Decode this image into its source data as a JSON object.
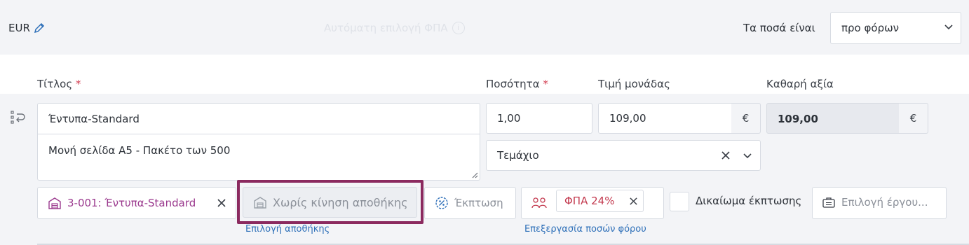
{
  "topbar": {
    "currency": "EUR",
    "currency_edit_icon": "pencil-icon",
    "ghost_text": "Αυτόματη επιλογή ΦΠΑ",
    "ghost_icon": "info-circle-icon",
    "amounts_label": "Τα ποσά είναι",
    "amounts_value": "προ φόρων"
  },
  "labels": {
    "title": "Τίτλος",
    "quantity": "Ποσότητα",
    "unit_price": "Τιμή μονάδας",
    "net_value": "Καθαρή αξία",
    "required_mark": "*"
  },
  "line": {
    "title": "Έντυπα-Standard",
    "description": "Μονή σελίδα Α5 - Πακέτο των 500",
    "quantity": "1,00",
    "unit_price": "109,00",
    "currency_symbol": "€",
    "net_value": "109,00",
    "unit": "Τεμάχιο"
  },
  "chips": {
    "product": "3-001: Έντυπα-Standard",
    "warehouse": "Χωρίς κίνηση αποθήκης",
    "discount": "Έκπτωση",
    "vat": "ΦΠΑ 24%",
    "deduction_right": "Δικαίωμα έκπτωσης",
    "project_placeholder": "Επιλογή έργου..."
  },
  "links": {
    "choose_warehouse": "Επιλογή αποθήκης",
    "edit_tax_amounts": "Επεξεργασία ποσών φόρου"
  },
  "colors": {
    "accent_purple": "#9b3a8e",
    "highlight_border": "#8b2a5f",
    "link_blue": "#2d6fb8",
    "required_red": "#d23b4f"
  }
}
